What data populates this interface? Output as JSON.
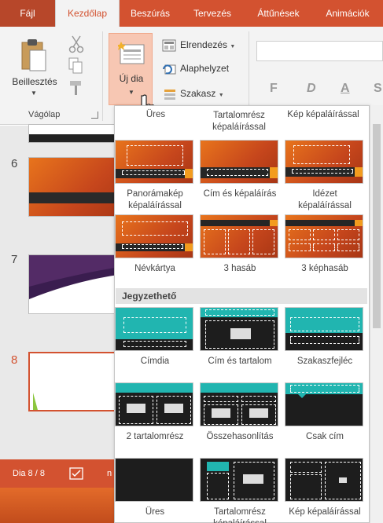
{
  "ribbon": {
    "tabs": [
      "Fájl",
      "Kezdőlap",
      "Beszúrás",
      "Tervezés",
      "Áttűnések",
      "Animációk"
    ],
    "paste_label": "Beillesztés",
    "clipboard_group": "Vágólap",
    "new_slide_label": "Új dia",
    "layout_label": "Elrendezés",
    "reset_label": "Alaphelyzet",
    "section_label": "Szakasz",
    "format_buttons": [
      "F",
      "D",
      "A",
      "S"
    ]
  },
  "thumbnails": {
    "numbers": [
      "6",
      "7",
      "8"
    ],
    "selected": "8"
  },
  "status": {
    "slide_counter": "Dia 8 / 8",
    "trailing": "n"
  },
  "gallery": {
    "top_row_partial": [
      "Üres",
      "Tartalomrész képaláírással",
      "Kép képaláírással"
    ],
    "theme_items": [
      "Panorámakép képaláírással",
      "Cím és képaláírás",
      "Idézet képaláírással",
      "Névkártya",
      "3 hasáb",
      "3 képhasáb"
    ],
    "section_title": "Jegyzethető",
    "notes_items": [
      "Címdia",
      "Cím és tartalom",
      "Szakaszfejléc",
      "2 tartalomrész",
      "Összehasonlítás",
      "Csak cím",
      "Üres",
      "Tartalomrész képaláírással",
      "Kép képaláírással"
    ]
  },
  "colors": {
    "accent": "#d35230",
    "orange_theme": "#e8741c",
    "teal_theme": "#21b5b0"
  }
}
